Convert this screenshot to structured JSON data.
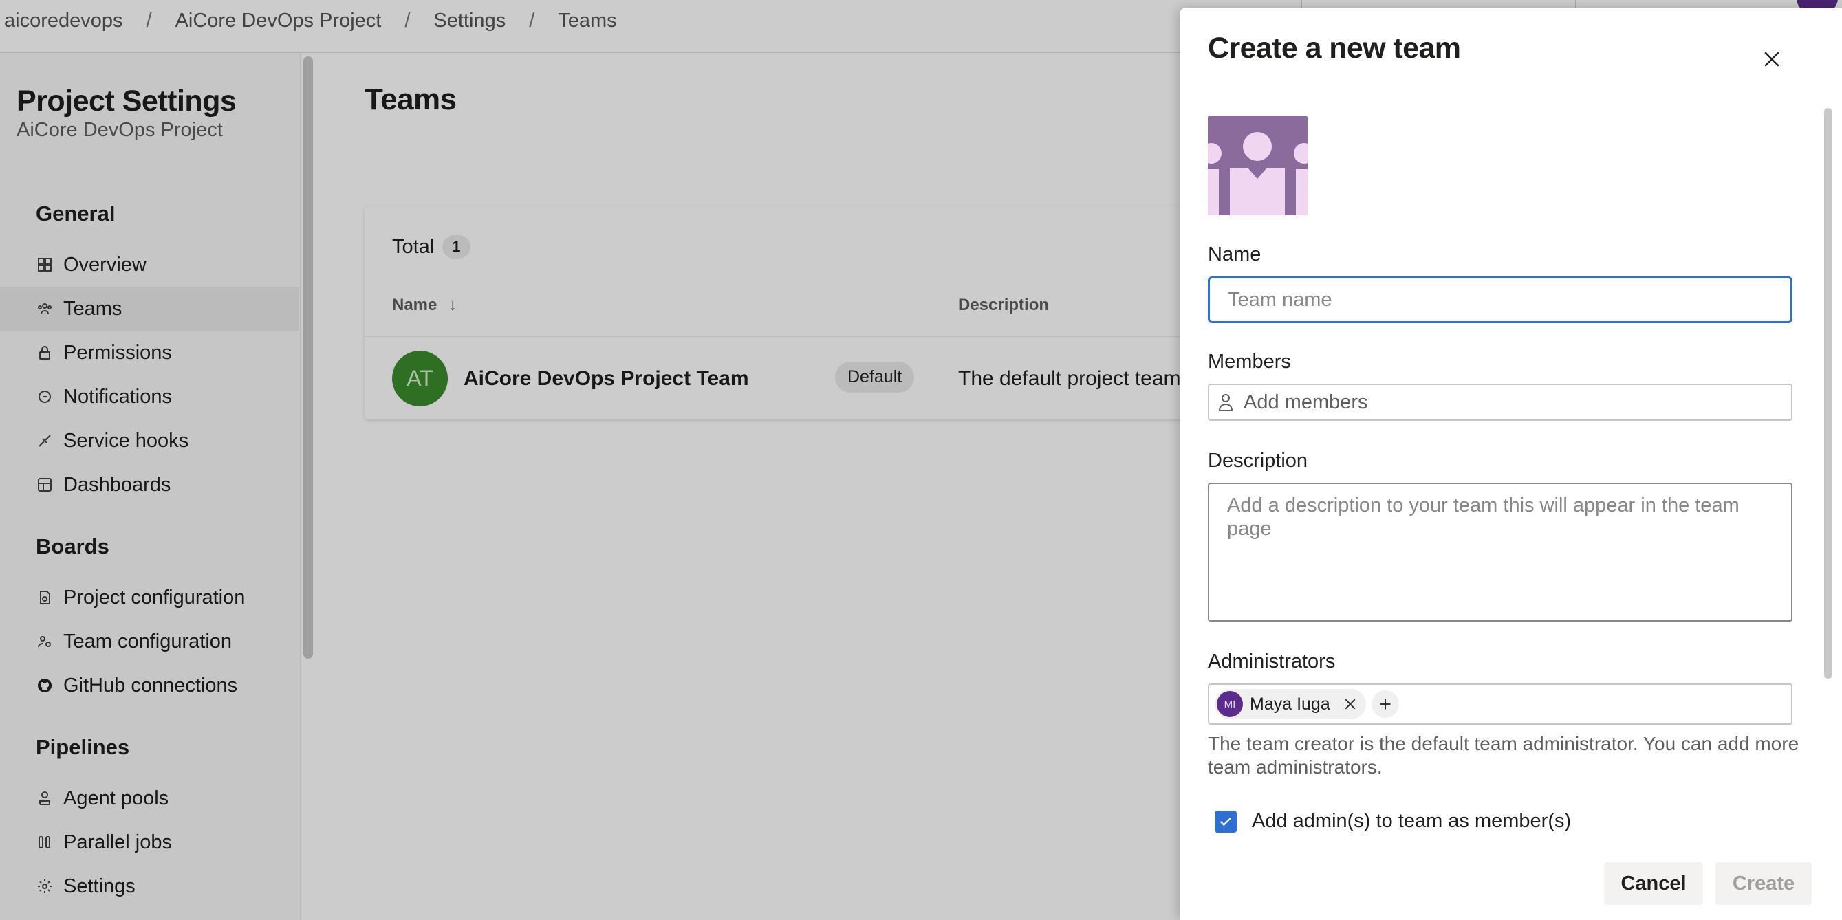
{
  "breadcrumb": [
    "aicoredevops",
    "AiCore DevOps Project",
    "Settings",
    "Teams"
  ],
  "breadcrumb_separator": "/",
  "sidebar": {
    "title": "Project Settings",
    "subtitle": "AiCore DevOps Project",
    "sections": {
      "general": "General",
      "boards": "Boards",
      "pipelines": "Pipelines"
    },
    "items": [
      {
        "label": "Overview",
        "icon": "overview-icon"
      },
      {
        "label": "Teams",
        "icon": "teams-icon",
        "selected": true
      },
      {
        "label": "Permissions",
        "icon": "lock-icon"
      },
      {
        "label": "Notifications",
        "icon": "notifications-icon"
      },
      {
        "label": "Service hooks",
        "icon": "service-hooks-icon"
      },
      {
        "label": "Dashboards",
        "icon": "dashboards-icon"
      },
      {
        "label": "Project configuration",
        "icon": "project-config-icon"
      },
      {
        "label": "Team configuration",
        "icon": "team-config-icon"
      },
      {
        "label": "GitHub connections",
        "icon": "github-icon"
      },
      {
        "label": "Agent pools",
        "icon": "agent-pools-icon"
      },
      {
        "label": "Parallel jobs",
        "icon": "parallel-jobs-icon"
      },
      {
        "label": "Settings",
        "icon": "gear-icon"
      }
    ]
  },
  "main": {
    "title": "Teams",
    "total_label": "Total",
    "total_count": "1",
    "columns": {
      "name": "Name",
      "sort_indicator": "↓",
      "description": "Description"
    },
    "rows": [
      {
        "initials": "AT",
        "name": "AiCore DevOps Project Team",
        "badge": "Default",
        "description": "The default project team."
      }
    ]
  },
  "panel": {
    "title": "Create a new team",
    "name_label": "Name",
    "name_placeholder": "Team name",
    "name_value": "",
    "members_label": "Members",
    "members_placeholder": "Add members",
    "description_label": "Description",
    "description_placeholder": "Add a description to your team this will appear in the team page",
    "administrators_label": "Administrators",
    "admin": {
      "initials": "MI",
      "name": "Maya Iuga"
    },
    "admin_help": "The team creator is the default team administrator. You can add more team administrators.",
    "checkbox_label": "Add admin(s) to team as member(s)",
    "checkbox_checked": true,
    "cancel_label": "Cancel",
    "create_label": "Create"
  },
  "colors": {
    "accent": "#2f6fd0",
    "team_avatar": "#3b8b2e",
    "admin_avatar": "#5a2d8c",
    "team_image": "#8a6b9b"
  }
}
